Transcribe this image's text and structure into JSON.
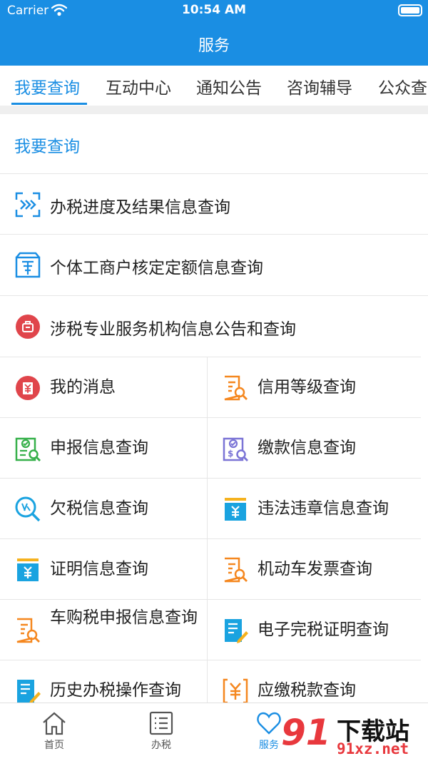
{
  "status_bar": {
    "carrier": "Carrier",
    "time": "10:54 AM"
  },
  "nav": {
    "title": "服务"
  },
  "tabs": [
    {
      "label": "我要查询"
    },
    {
      "label": "互动中心"
    },
    {
      "label": "通知公告"
    },
    {
      "label": "咨询辅导"
    },
    {
      "label": "公众查"
    }
  ],
  "section": {
    "title": "我要查询"
  },
  "rows": [
    {
      "label": "办税进度及结果信息查询",
      "icon": "progress-scan-icon"
    },
    {
      "label": "个体工商户核定定额信息查询",
      "icon": "shop-icon"
    },
    {
      "label": "涉税专业服务机构信息公告和查询",
      "icon": "briefcase-icon"
    }
  ],
  "grid": [
    {
      "label": "我的消息",
      "icon": "message-yen-icon"
    },
    {
      "label": "信用等级查询",
      "icon": "document-search-icon"
    },
    {
      "label": "申报信息查询",
      "icon": "declare-search-icon"
    },
    {
      "label": "缴款信息查询",
      "icon": "payment-search-icon"
    },
    {
      "label": "欠税信息查询",
      "icon": "arrears-search-icon"
    },
    {
      "label": "违法违章信息查询",
      "icon": "yen-card-icon"
    },
    {
      "label": "证明信息查询",
      "icon": "yen-card-icon"
    },
    {
      "label": "机动车发票查询",
      "icon": "document-search-icon"
    },
    {
      "label": "车购税申报信息查询",
      "icon": "document-search-icon"
    },
    {
      "label": "电子完税证明查询",
      "icon": "edit-document-icon"
    },
    {
      "label": "历史办税操作查询",
      "icon": "edit-document-icon"
    },
    {
      "label": "应缴税款查询",
      "icon": "yen-frame-icon"
    }
  ],
  "bottom_nav": [
    {
      "label": "首页",
      "icon": "home-icon"
    },
    {
      "label": "办税",
      "icon": "list-icon"
    },
    {
      "label": "服务",
      "icon": "heart-icon"
    }
  ],
  "watermark": {
    "big": "91",
    "text": "下载站",
    "url": "91xz.net"
  },
  "colors": {
    "primary": "#1a8ee3",
    "orange": "#f5871f",
    "green": "#36b04a",
    "red": "#e0454b",
    "purple": "#7b74d6"
  }
}
